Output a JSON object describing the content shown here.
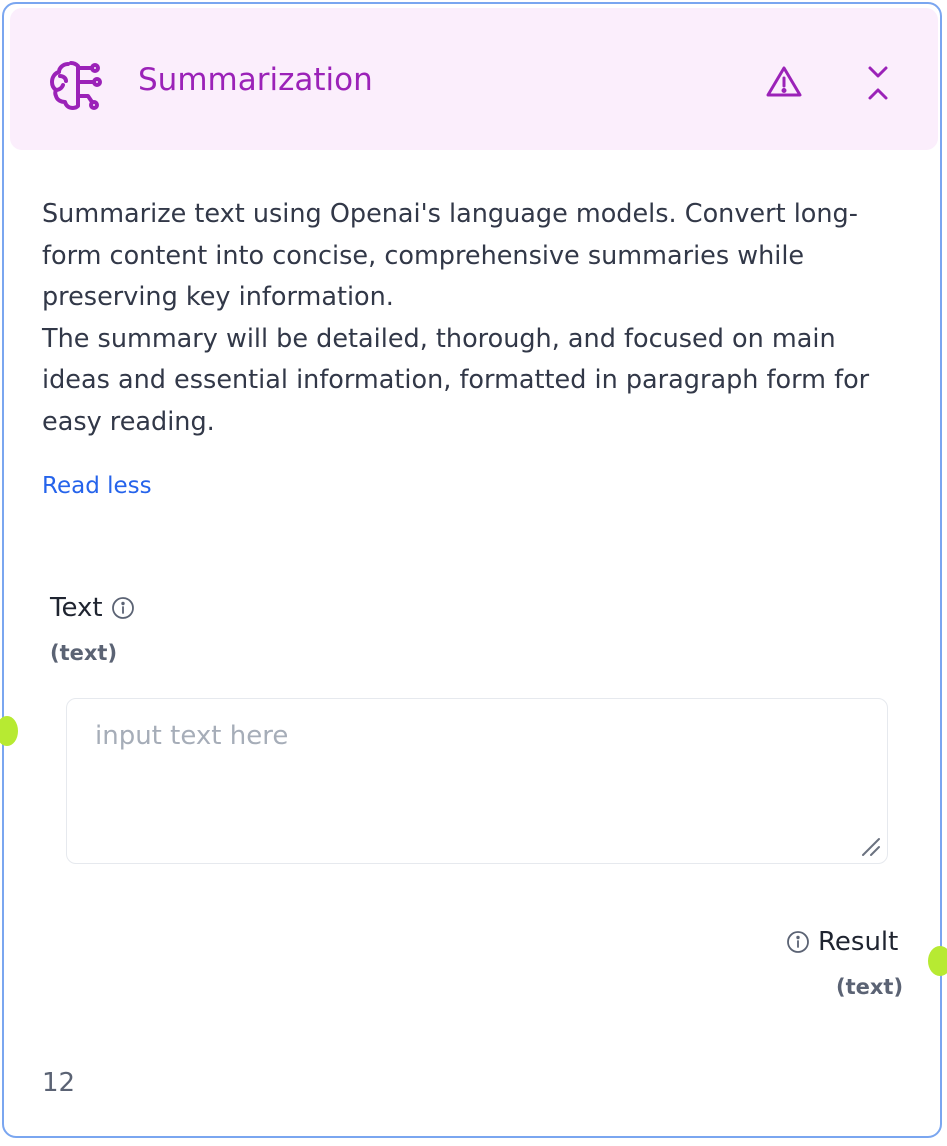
{
  "node": {
    "title": "Summarization",
    "icon": "brain-circuit-icon",
    "accent_color": "#9b22b8",
    "header_bg": "#fbeefc",
    "border_color": "#7aa6f0"
  },
  "description": {
    "paragraph_1": "Summarize text using Openai's language models. Convert long-form content into concise, comprehensive summaries while preserving key information.",
    "paragraph_2": "The summary will be detailed, thorough, and focused on main ideas and essential information, formatted in paragraph form for easy reading.",
    "toggle_label": "Read less"
  },
  "input": {
    "label": "Text",
    "type": "(text)",
    "placeholder": "input text here",
    "value": ""
  },
  "output": {
    "label": "Result",
    "type": "(text)"
  },
  "footer": {
    "node_id": "12"
  },
  "handle_color": "#b7ea32"
}
